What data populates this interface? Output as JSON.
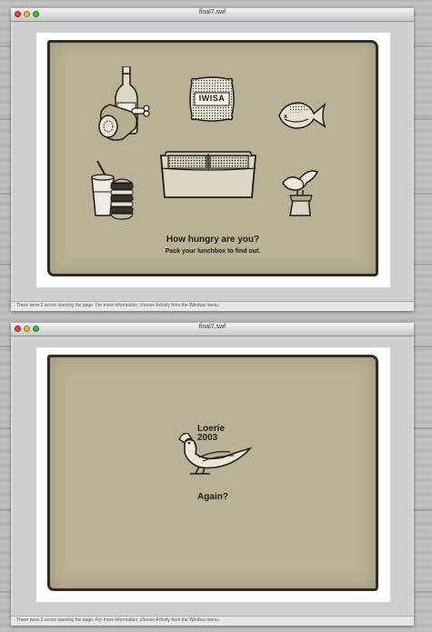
{
  "colors": {
    "panel": "#bab196",
    "ink": "#2f2b24",
    "stage": "#ffffff",
    "red": "#e0443e",
    "yellow": "#e9b53a",
    "green": "#4bb43f"
  },
  "window1": {
    "title": "final7.swf",
    "sack_label": "IWISA",
    "headline": "How hungry are you?",
    "subline": "Pack your lunchbox to find out.",
    "status": "There were 2 errors opening the page. For more information, choose Activity from the Window menu.",
    "icons": [
      "bottle-and-ham-icon",
      "maize-meal-sack-icon",
      "fish-icon",
      "lunchbox-icon",
      "soda-and-burger-icon",
      "bird-on-pedestal-icon"
    ]
  },
  "window2": {
    "title": "final7.swf",
    "award_line1": "Loerie",
    "award_line2": "2003",
    "again": "Again?",
    "status": "There were 2 errors opening the page. For more information, choose Activity from the Window menu.",
    "icons": [
      "loerie-bird-icon"
    ]
  }
}
